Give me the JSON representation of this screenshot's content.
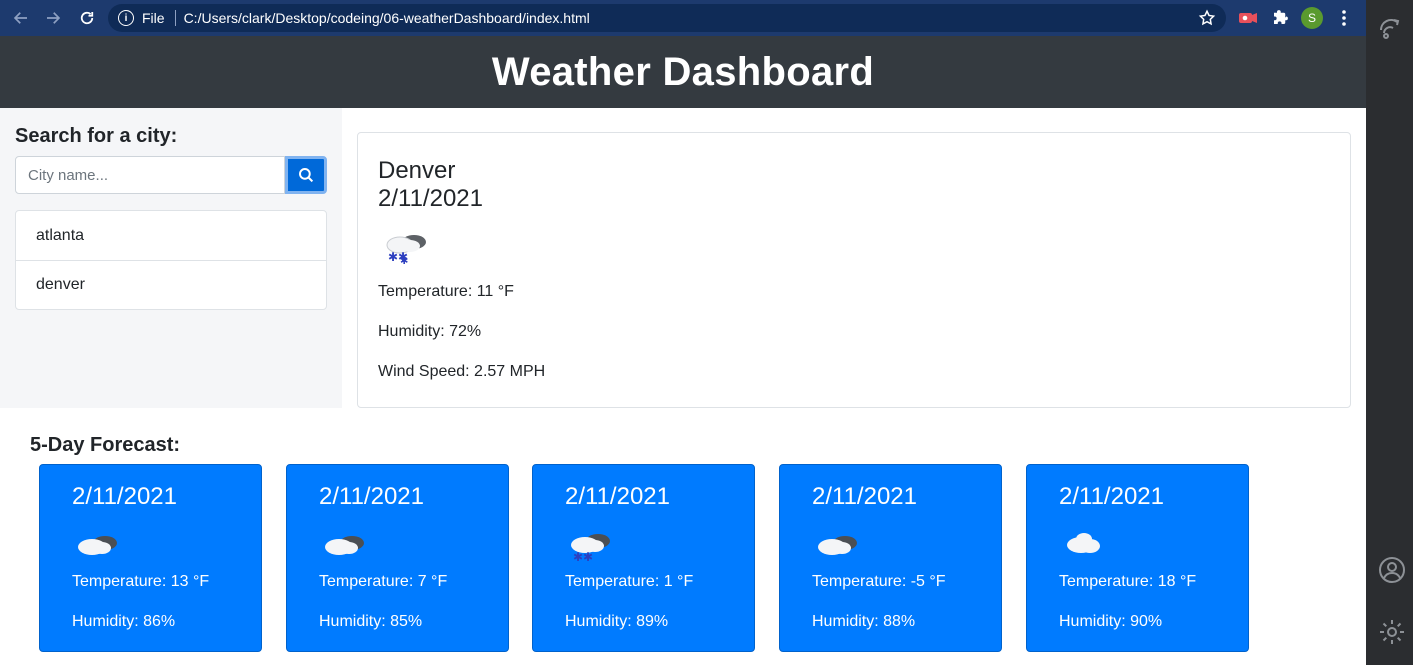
{
  "browser": {
    "file_label": "File",
    "url": "C:/Users/clark/Desktop/codeing/06-weatherDashboard/index.html",
    "profile_initial": "S"
  },
  "header": {
    "title": "Weather Dashboard"
  },
  "search": {
    "heading": "Search for a city:",
    "placeholder": "City name...",
    "history": [
      "atlanta",
      "denver"
    ]
  },
  "current": {
    "city": "Denver",
    "date": "2/11/2021",
    "icon": "snow-cloud-icon",
    "temperature": "Temperature: 11 °F",
    "humidity": "Humidity: 72%",
    "wind": "Wind Speed: 2.57 MPH"
  },
  "forecast": {
    "title": "5-Day Forecast:",
    "days": [
      {
        "date": "2/11/2021",
        "icon": "cloudy-icon",
        "temp": "Temperature: 13 °F",
        "humidity": "Humidity: 86%"
      },
      {
        "date": "2/11/2021",
        "icon": "cloudy-icon",
        "temp": "Temperature: 7 °F",
        "humidity": "Humidity: 85%"
      },
      {
        "date": "2/11/2021",
        "icon": "snow-cloud-icon",
        "temp": "Temperature: 1 °F",
        "humidity": "Humidity: 89%"
      },
      {
        "date": "2/11/2021",
        "icon": "cloudy-icon",
        "temp": "Temperature: -5 °F",
        "humidity": "Humidity: 88%"
      },
      {
        "date": "2/11/2021",
        "icon": "cloud-icon",
        "temp": "Temperature: 18 °F",
        "humidity": "Humidity: 90%"
      }
    ]
  },
  "colors": {
    "header_bg": "#343a40",
    "card_bg": "#007bff",
    "button_bg": "#0069d9"
  }
}
